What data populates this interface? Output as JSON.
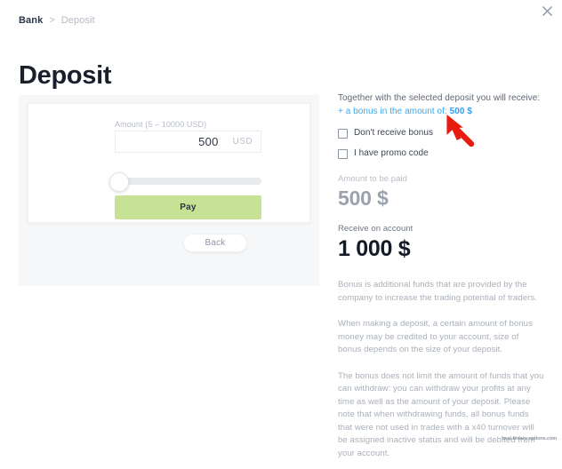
{
  "window": {
    "close_label": "×",
    "close_icon": "close-icon"
  },
  "breadcrumb": {
    "root": "Bank",
    "separator": ">",
    "current": "Deposit"
  },
  "page_title": "Deposit",
  "form": {
    "amount_label": "Amount (5 – 10000 USD)",
    "amount_value": "500",
    "currency": "USD",
    "slider": {
      "value": 0,
      "min": 5,
      "max": 10000
    },
    "pay_label": "Pay",
    "back_label": "Back"
  },
  "summary": {
    "receive_intro": "Together with the selected deposit you will receive:",
    "bonus_link_prefix": "+ a bonus in the amount of: ",
    "bonus_link_amount": "500 $",
    "checkboxes": [
      {
        "label": "Don't receive bonus",
        "checked": false
      },
      {
        "label": "I have promo code",
        "checked": false
      }
    ],
    "amount_to_be_paid_label": "Amount to be paid",
    "amount_to_be_paid_value": "500 $",
    "receive_on_account_label": "Receive on account",
    "receive_on_account_value": "1 000 $"
  },
  "info": {
    "paragraph_1": "Bonus is additional funds that are provided by the company to increase the trading potential of traders.",
    "paragraph_2": "When making a deposit, a certain amount of bonus money may be credited to your account, size of bonus depends on the size of your deposit.",
    "paragraph_3": "The bonus does not limit the amount of funds that you can withdraw: you can withdraw your profits at any time as well as the amount of your deposit. Please note that when withdrawing funds, all bonus funds that were not used in trades with a x40 turnover will be assigned inactive status and will be debited from your account."
  },
  "annotation": {
    "arrow_icon": "red-arrow-cursor",
    "arrow_color": "#e81b10"
  },
  "watermark": "best-binary-options.com",
  "colors": {
    "accent_blue": "#3ba7ef",
    "pay_green": "#c8e295",
    "title_dark": "#19202c",
    "muted_gray": "#a9b0ba",
    "panel_bg": "#f6f7f8"
  }
}
